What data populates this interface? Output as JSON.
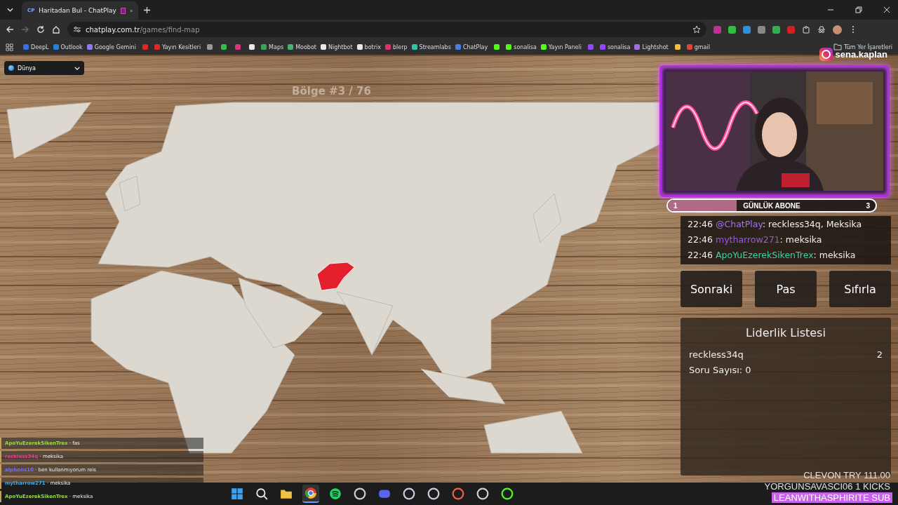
{
  "browser": {
    "tabs": [
      {
        "icon": "CP",
        "title": "Haritadan Bul - ChatPlay",
        "selected": true
      }
    ],
    "url_host": "chatplay.com.tr",
    "url_path": "/games/find-map"
  },
  "bookmarks": [
    {
      "label": "DeepL",
      "color": "#3a6ee8"
    },
    {
      "label": "Outlook",
      "color": "#2a7de1"
    },
    {
      "label": "Google Gemini",
      "color": "#8a7cf0"
    },
    {
      "color": "#e0262b"
    },
    {
      "label": "Yayın Kesitleri",
      "color": "#e0262b"
    },
    {
      "color": "#9a9a9a"
    },
    {
      "color": "#2fbf4a"
    },
    {
      "color": "#d6387a"
    },
    {
      "color": "#e8e8e8"
    },
    {
      "label": "Maps",
      "color": "#3aa55a"
    },
    {
      "label": "Moobot",
      "color": "#45b36b"
    },
    {
      "label": "Nightbot",
      "color": "#e8e8e8"
    },
    {
      "label": "botrix",
      "color": "#e8e8e8"
    },
    {
      "label": "blerp",
      "color": "#e0306a"
    },
    {
      "label": "Streamlabs",
      "color": "#31c3a2"
    },
    {
      "label": "ChatPlay",
      "color": "#4a7de8"
    },
    {
      "color": "#53fc18"
    },
    {
      "label": "sonalisa",
      "color": "#53fc18"
    },
    {
      "label": "Yayın Paneli",
      "color": "#53fc18"
    },
    {
      "color": "#9146ff"
    },
    {
      "label": "sonalisa",
      "color": "#9146ff"
    },
    {
      "label": "Lightshot",
      "color": "#a070e0"
    },
    {
      "color": "#f0c040"
    },
    {
      "label": "gmail",
      "color": "#e0443a"
    }
  ],
  "all_bookmarks": "Tüm Yer İşaretleri",
  "region_select": {
    "value": "Dünya"
  },
  "map": {
    "title": "Bölge #3 / 76"
  },
  "stream": {
    "instagram": "sena.kaplan",
    "chat": [
      {
        "time": "22:46",
        "user": "@ChatPlay",
        "color": "#a070f0",
        "message": ": reckless34q, Meksika"
      },
      {
        "time": "22:46",
        "user": "mytharrow271",
        "color": "#9a55e8",
        "message": ": meksika"
      },
      {
        "time": "22:46",
        "user": "ApoYuEzerekSikenTrex",
        "color": "#3ad6a8",
        "message": ": meksika"
      }
    ],
    "goal": {
      "current": "1",
      "label": "GÜNLÜK ABONE",
      "target": "3",
      "level": 0.33
    }
  },
  "buttons": [
    "Sonraki",
    "Pas",
    "Sıfırla"
  ],
  "leaderboard": {
    "title": "Liderlik Listesi",
    "rows": [
      {
        "name": "reckless34q",
        "score": "2"
      }
    ],
    "question_count": "Soru Sayısı: 0"
  },
  "alerts": [
    {
      "text": "CLEVON  TRY 111.00",
      "highlighted": false
    },
    {
      "text": "YORGUNSAVASCI06  1 KICKS",
      "highlighted": false
    },
    {
      "text": "LEANWITHASPHIRITE  SUB",
      "highlighted": true
    }
  ],
  "overlay_chat": [
    {
      "user": "ApoYuEzerekSikenTrex",
      "color": "#8fe03a",
      "message": "· fas"
    },
    {
      "user": "reckless34q",
      "color": "#e0409b",
      "message": "· meksika"
    },
    {
      "user": "alphons10",
      "color": "#7a6cf0",
      "message": "· ben kullanmıyorum reis"
    },
    {
      "user": "mytharrow271",
      "color": "#4aa8e0",
      "message": "· meksika"
    },
    {
      "user": "ApoYuEzerekSikenTrex",
      "color": "#8fe03a",
      "message": "· meksika"
    }
  ]
}
